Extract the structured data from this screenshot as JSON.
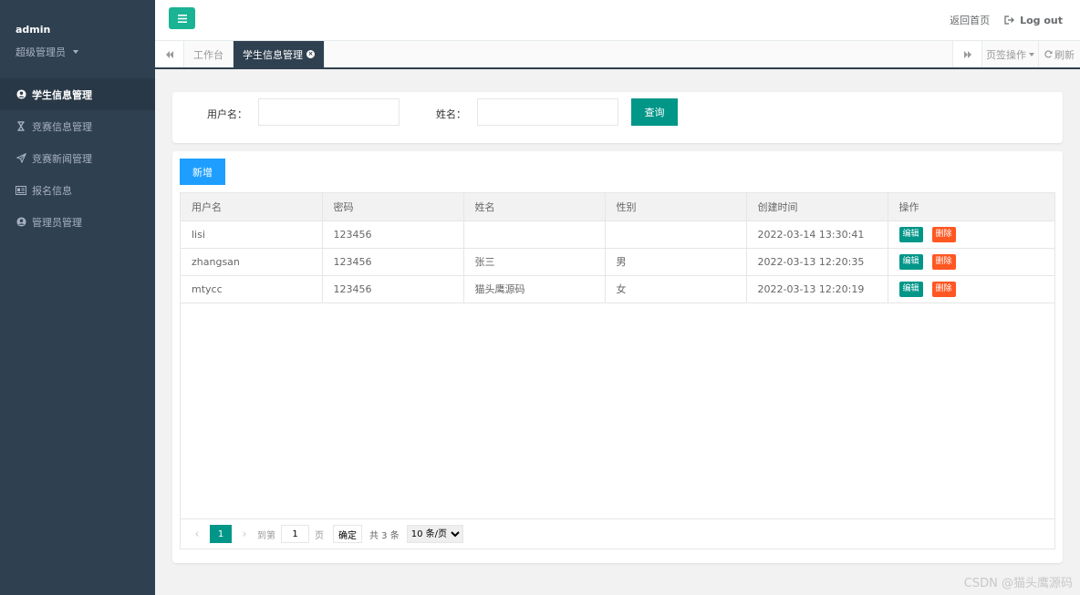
{
  "sidebar": {
    "user_name": "admin",
    "user_role": "超级管理员",
    "items": [
      {
        "label": "学生信息管理",
        "icon": "user-circle-icon",
        "active": true
      },
      {
        "label": "竞赛信息管理",
        "icon": "hourglass-icon",
        "active": false
      },
      {
        "label": "竞赛新闻管理",
        "icon": "paper-plane-icon",
        "active": false
      },
      {
        "label": "报名信息",
        "icon": "id-card-icon",
        "active": false
      },
      {
        "label": "管理员管理",
        "icon": "user-circle-icon",
        "active": false
      }
    ]
  },
  "topbar": {
    "home_label": "返回首页",
    "logout_label": "Log out"
  },
  "tabs": {
    "items": [
      {
        "label": "工作台",
        "active": false
      },
      {
        "label": "学生信息管理",
        "active": true
      }
    ],
    "ops_label": "页签操作",
    "refresh_label": "刷新"
  },
  "search": {
    "username_label": "用户名：",
    "username_value": "",
    "name_label": "姓名：",
    "name_value": "",
    "query_label": "查询"
  },
  "table": {
    "add_label": "新增",
    "columns": [
      "用户名",
      "密码",
      "姓名",
      "性别",
      "创建时间",
      "操作"
    ],
    "rows": [
      {
        "username": "lisi",
        "password": "123456",
        "name": "",
        "gender": "",
        "created": "2022-03-14 13:30:41"
      },
      {
        "username": "zhangsan",
        "password": "123456",
        "name": "张三",
        "gender": "男",
        "created": "2022-03-13 12:20:35"
      },
      {
        "username": "mtycc",
        "password": "123456",
        "name": "猫头鹰源码",
        "gender": "女",
        "created": "2022-03-13 12:20:19"
      }
    ],
    "edit_label": "编辑",
    "delete_label": "删除"
  },
  "pager": {
    "current_page": "1",
    "goto_label": "到第",
    "goto_value": "1",
    "page_unit": "页",
    "confirm_label": "确定",
    "total_label": "共 3 条",
    "page_size_label": "10 条/页"
  },
  "watermark": "CSDN @猫头鹰源码",
  "colors": {
    "sidebar_bg": "#2f4050",
    "primary_green": "#009688",
    "toggle_green": "#1ab394",
    "add_blue": "#1e9fff",
    "delete_orange": "#ff5722"
  }
}
